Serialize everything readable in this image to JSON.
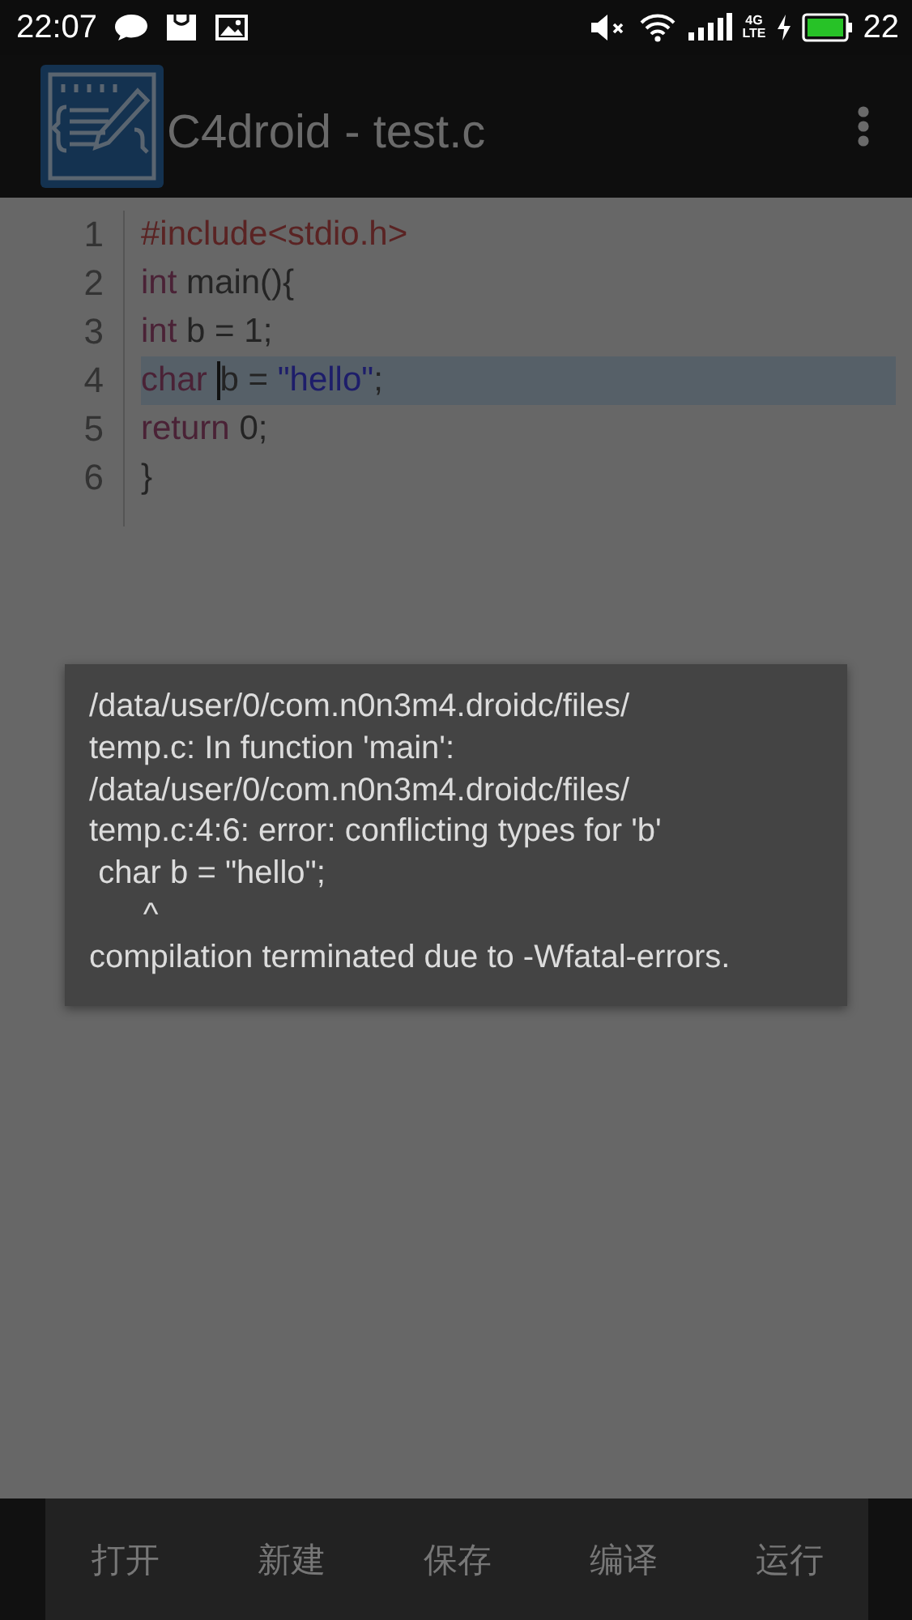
{
  "status_bar": {
    "time": "22:07",
    "network_top": "4G",
    "network_bottom": "LTE",
    "battery": "22"
  },
  "app_bar": {
    "title": "C4droid - test.c"
  },
  "editor": {
    "lines": [
      {
        "number": "1",
        "current": false,
        "tokens": [
          {
            "text": "#include<stdio.h>",
            "kind": "directive"
          }
        ]
      },
      {
        "number": "2",
        "current": false,
        "tokens": [
          {
            "text": "int",
            "kind": "keyword"
          },
          {
            "text": " main(){",
            "kind": "plain"
          }
        ]
      },
      {
        "number": "3",
        "current": false,
        "tokens": [
          {
            "text": "int",
            "kind": "keyword"
          },
          {
            "text": " b = 1;",
            "kind": "plain"
          }
        ]
      },
      {
        "number": "4",
        "current": true,
        "tokens": [
          {
            "text": "char ",
            "kind": "keyword"
          },
          {
            "kind": "cursor"
          },
          {
            "text": "b = ",
            "kind": "plain"
          },
          {
            "text": "\"hello\"",
            "kind": "string"
          },
          {
            "text": ";",
            "kind": "plain"
          }
        ]
      },
      {
        "number": "5",
        "current": false,
        "tokens": [
          {
            "text": "return",
            "kind": "keyword"
          },
          {
            "text": " 0;",
            "kind": "plain"
          }
        ]
      },
      {
        "number": "6",
        "current": false,
        "tokens": [
          {
            "text": "}",
            "kind": "plain"
          }
        ]
      }
    ]
  },
  "toast": {
    "message": "/data/user/0/com.n0n3m4.droidc/files/\ntemp.c: In function 'main':\n/data/user/0/com.n0n3m4.droidc/files/\ntemp.c:4:6: error: conflicting types for 'b'\n char b = \"hello\";\n      ^\ncompilation terminated due to -Wfatal-errors."
  },
  "bottom_bar": {
    "buttons": [
      "打开",
      "新建",
      "保存",
      "编译",
      "运行"
    ]
  }
}
